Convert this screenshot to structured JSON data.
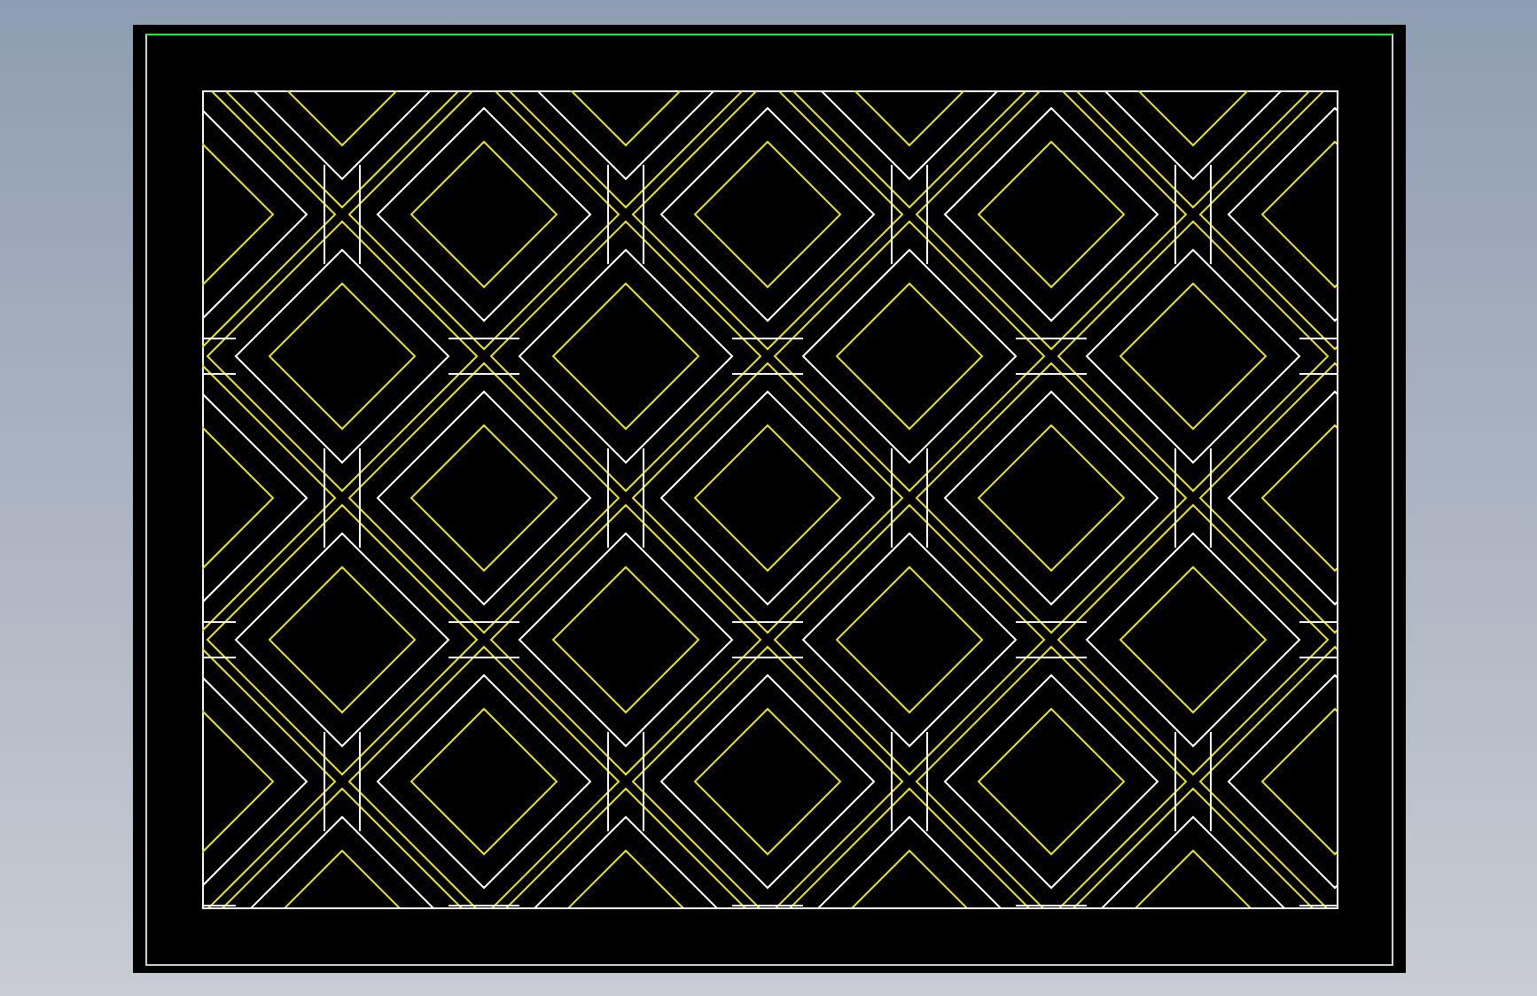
{
  "viewport": {
    "kind": "drawing"
  }
}
